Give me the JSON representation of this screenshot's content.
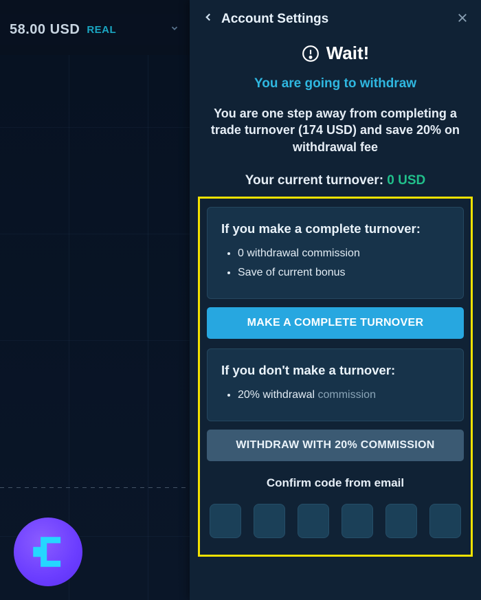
{
  "balance": {
    "amount": "58.00 USD",
    "tag": "REAL"
  },
  "panel": {
    "title": "Account Settings",
    "wait": "Wait!",
    "sub1": "You are going to withdraw",
    "desc_pre": "You are one step away from completing a trade turnover ",
    "desc_bold": "(174 USD)",
    "desc_post": " and save 20% on withdrawal fee",
    "turnover_label": "Your current turnover: ",
    "turnover_value": "0 USD"
  },
  "card1": {
    "title": "If you make a complete turnover:",
    "bullet1": "0 withdrawal commission",
    "bullet2": "Save of current bonus",
    "button": "MAKE A COMPLETE TURNOVER"
  },
  "card2": {
    "title": "If you don't make a turnover:",
    "bullet_a": "20% withdrawal ",
    "bullet_b": "commission",
    "button": "WITHDRAW WITH 20% COMMISSION"
  },
  "confirm_label": "Confirm code from email"
}
